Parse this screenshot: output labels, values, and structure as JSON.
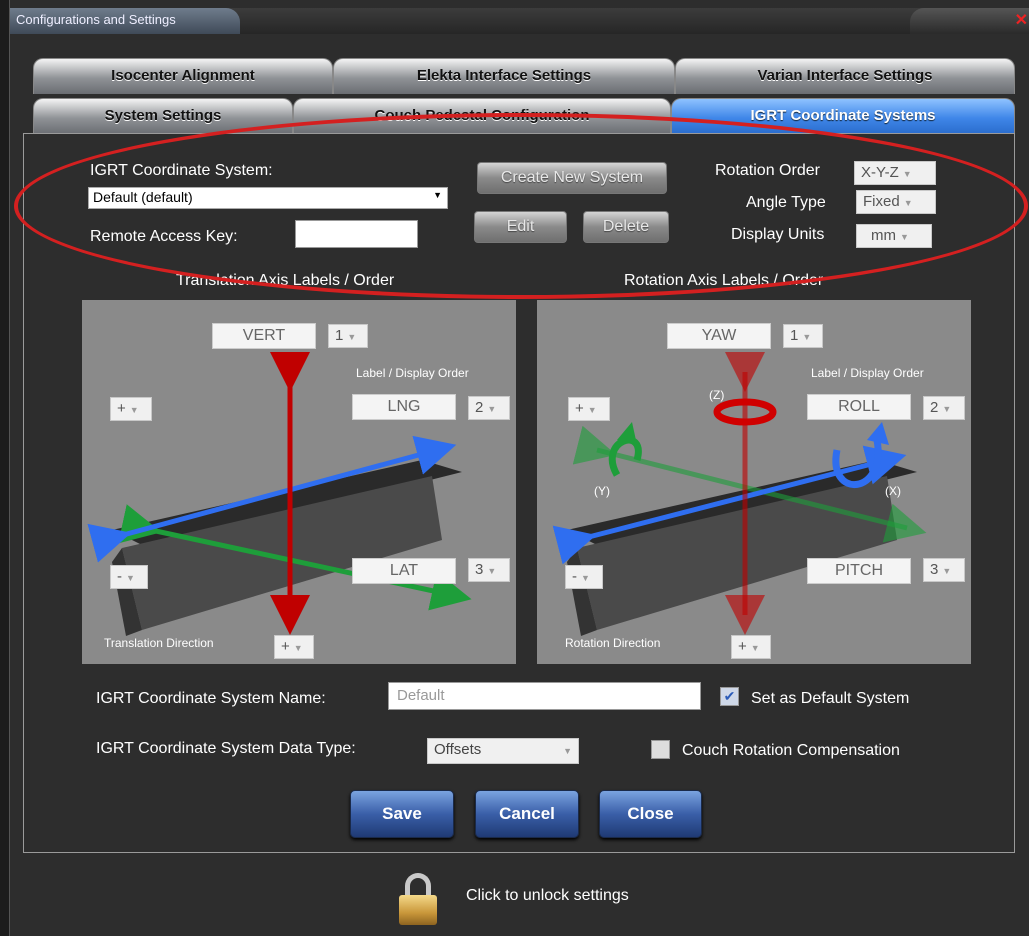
{
  "window": {
    "title": "Configurations and Settings",
    "close_glyph": "✕"
  },
  "tabs_row1": [
    {
      "label": "Isocenter Alignment"
    },
    {
      "label": "Elekta Interface Settings"
    },
    {
      "label": "Varian Interface Settings"
    }
  ],
  "tabs_row2": [
    {
      "label": "System Settings"
    },
    {
      "label": "Couch Pedestal Configuration"
    },
    {
      "label": "IGRT Coordinate Systems",
      "active": true
    }
  ],
  "top": {
    "igrt_label": "IGRT Coordinate System:",
    "igrt_value": "Default (default)",
    "remote_label": "Remote Access Key:",
    "remote_value": "",
    "create_btn": "Create New System",
    "edit_btn": "Edit",
    "delete_btn": "Delete",
    "rotation_order_label": "Rotation Order",
    "rotation_order_value": "X-Y-Z",
    "angle_type_label": "Angle Type",
    "angle_type_value": "Fixed",
    "display_units_label": "Display Units",
    "display_units_value": "mm"
  },
  "translation": {
    "heading": "Translation Axis Labels / Order",
    "label_order": "Label / Display Order",
    "vert": "VERT",
    "vert_order": "1",
    "lng": "LNG",
    "lng_order": "2",
    "lat": "LAT",
    "lat_order": "3",
    "plus_sign": "+",
    "minus_sign": "-",
    "bottom_sign": "+",
    "direction_label": "Translation Direction"
  },
  "rotation": {
    "heading": "Rotation Axis Labels / Order",
    "label_order": "Label / Display Order",
    "yaw": "YAW",
    "yaw_order": "1",
    "roll": "ROLL",
    "roll_order": "2",
    "pitch": "PITCH",
    "pitch_order": "3",
    "plus_sign": "+",
    "minus_sign": "-",
    "bottom_sign": "+",
    "z_label": "(Z)",
    "y_label": "(Y)",
    "x_label": "(X)",
    "direction_label": "Rotation Direction"
  },
  "bottom": {
    "name_label": "IGRT Coordinate System Name:",
    "name_placeholder": "Default",
    "default_label": "Set as Default System",
    "default_checked": true,
    "datatype_label": "IGRT Coordinate System Data Type:",
    "datatype_value": "Offsets",
    "couch_label": "Couch Rotation Compensation",
    "couch_checked": false
  },
  "buttons": {
    "save": "Save",
    "cancel": "Cancel",
    "close": "Close"
  },
  "lock": {
    "text": "Click to unlock settings"
  },
  "colors": {
    "accent_blue": "#3f86e8",
    "annotation_red": "#d42020",
    "axis_red": "#c00000",
    "axis_green": "#1e9e3a",
    "axis_blue": "#2f6ef0"
  }
}
